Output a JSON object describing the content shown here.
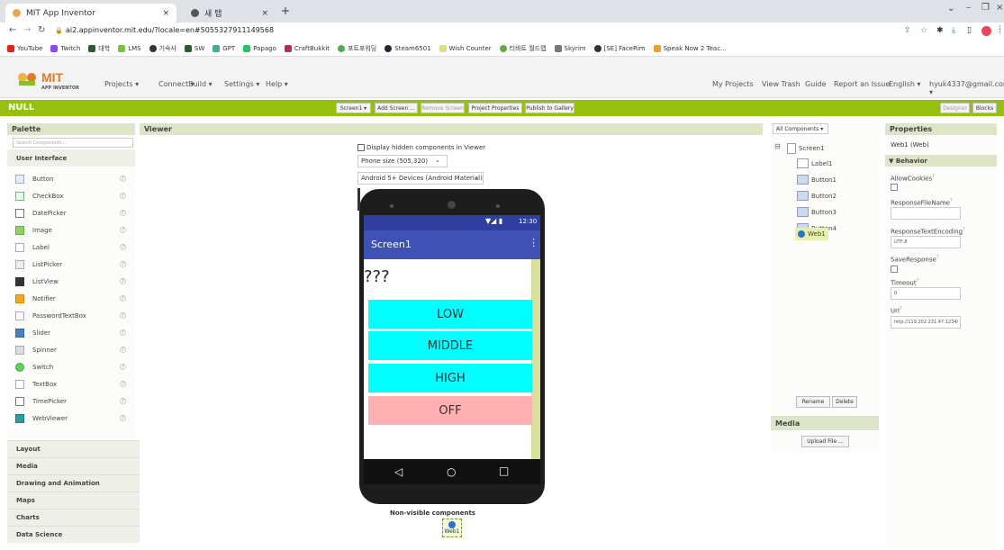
{
  "browser": {
    "tabs": [
      {
        "title": "MIT App Inventor"
      },
      {
        "title": "새 탭"
      }
    ],
    "new_tab_glyph": "+",
    "url": "ai2.appinventor.mit.edu/?locale=en#5055327911149568",
    "bookmarks": [
      "YouTube",
      "Twitch",
      "대학",
      "LMS",
      "기숙사",
      "SW",
      "GPT",
      "Papago",
      "CraftBukkit",
      "포트포워딩",
      "Steam6501",
      "Wish Counter",
      "티바트 월드맵",
      "Skyrim",
      "[SE] FaceRim",
      "Speak Now 2 Teac..."
    ],
    "colors": {
      "tabstrip": "#dee1e6"
    }
  },
  "app": {
    "logo_title": "MIT",
    "logo_sub": "APP INVENTOR",
    "menus": [
      "Projects ▾",
      "Connect ▾",
      "Build ▾",
      "Settings ▾",
      "Help ▾"
    ],
    "right_links": [
      "My Projects",
      "View Trash",
      "Guide",
      "Report an Issue",
      "English ▾",
      "hyuk4337@gmail.com ▾"
    ]
  },
  "toolbar": {
    "project_name": "NULL",
    "screen_select": "Screen1 ▾",
    "add_screen": "Add Screen ...",
    "remove_screen": "Remove Screen",
    "project_properties": "Project Properties",
    "publish": "Publish to Gallery",
    "designer": "Designer",
    "blocks": "Blocks",
    "color": "#95c00d"
  },
  "palette": {
    "title": "Palette",
    "search_placeholder": "Search Components...",
    "open_category": "User Interface",
    "items": [
      "Button",
      "CheckBox",
      "DatePicker",
      "Image",
      "Label",
      "ListPicker",
      "ListView",
      "Notifier",
      "PasswordTextBox",
      "Slider",
      "Spinner",
      "Switch",
      "TextBox",
      "TimePicker",
      "WebViewer"
    ],
    "help_glyph": "?",
    "categories": [
      "Layout",
      "Media",
      "Drawing and Animation",
      "Maps",
      "Charts",
      "Data Science"
    ]
  },
  "viewer": {
    "title": "Viewer",
    "hidden_label": "Display hidden components in Viewer",
    "phone_size": "Phone size (505,320)",
    "theme": "Android 5+ Devices (Android Material)",
    "status_time": "12:30",
    "screen_title": "Screen1",
    "menu_dots": "⋮",
    "label_text": "???",
    "buttons": [
      {
        "text": "LOW",
        "color": "#00ffff"
      },
      {
        "text": "MIDDLE",
        "color": "#00ffff"
      },
      {
        "text": "HIGH",
        "color": "#00ffff"
      },
      {
        "text": "OFF",
        "color": "#ffafaf"
      }
    ],
    "nav": [
      "◁",
      "○",
      "□"
    ],
    "nonvisible_title": "Non-visible components",
    "nonvisible_item": "Web1",
    "colors": {
      "actionbar": "#3f51b5",
      "statusbar": "#303f9f"
    }
  },
  "components": {
    "dropdown": "All Components ▾",
    "toggle": "⊟",
    "root": "Screen1",
    "children": [
      "Label1",
      "Button1",
      "Button2",
      "Button3",
      "Button4",
      "Web1"
    ],
    "selected": "Web1",
    "rename": "Rename",
    "delete": "Delete",
    "media_title": "Media",
    "upload": "Upload File ..."
  },
  "properties": {
    "title": "Properties",
    "component": "Web1 (Web)",
    "section": "▼ Behavior",
    "help_glyph": "?",
    "allow_cookies": "AllowCookies",
    "response_file_name": "ResponseFileName",
    "response_text_encoding": "ResponseTextEncoding",
    "response_text_encoding_value": "UTF-8",
    "save_response": "SaveResponse",
    "timeout": "Timeout",
    "timeout_value": "0",
    "url": "Url",
    "url_value": "http://119.202.231.47:1234/"
  }
}
